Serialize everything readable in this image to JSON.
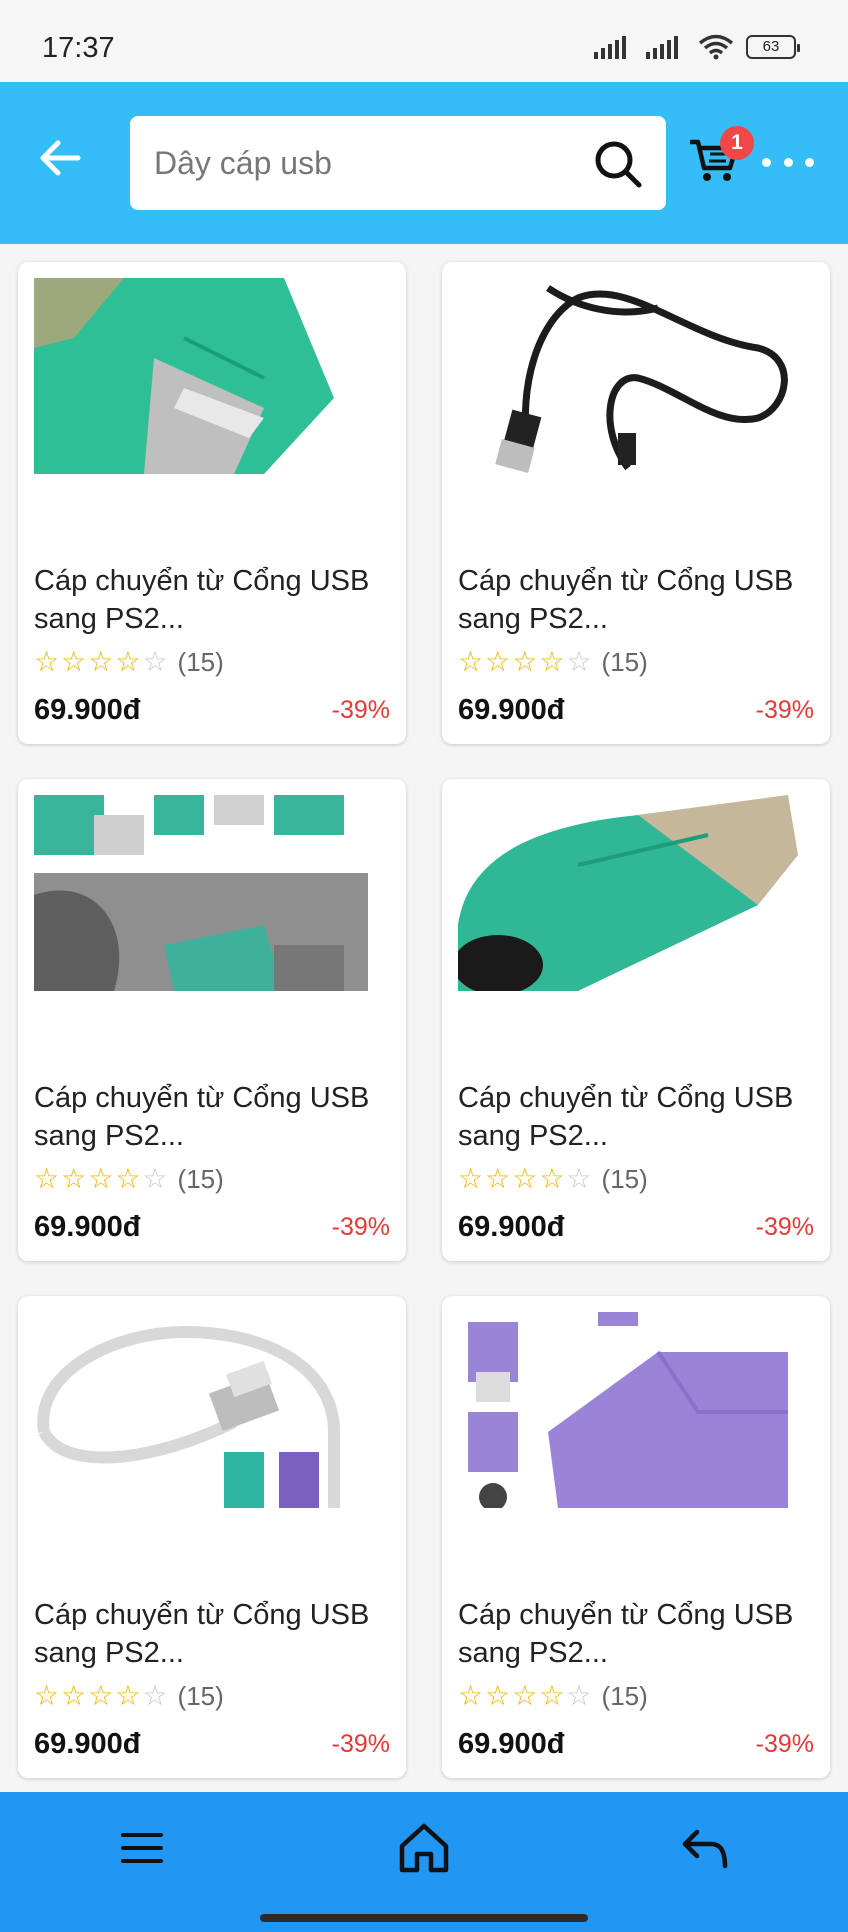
{
  "status_bar": {
    "time": "17:37",
    "battery": "63"
  },
  "header": {
    "search_placeholder": "Dây cáp usb",
    "cart_count": "1",
    "background_color": "#34bdf6",
    "icons": [
      "back-arrow-icon",
      "search-icon",
      "cart-icon",
      "more-icon"
    ]
  },
  "products": [
    {
      "title": "Cáp chuyển từ Cổng USB sang PS2...",
      "rating": 4,
      "reviews": "(15)",
      "price": "69.900đ",
      "discount": "-39%",
      "image": "green-usb-ps2-adapter-closeup"
    },
    {
      "title": "Cáp chuyển từ Cổng USB sang PS2...",
      "rating": 4,
      "reviews": "(15)",
      "price": "69.900đ",
      "discount": "-39%",
      "image": "black-usb-cable"
    },
    {
      "title": "Cáp chuyển từ Cổng USB sang PS2...",
      "rating": 4,
      "reviews": "(15)",
      "price": "69.900đ",
      "discount": "-39%",
      "image": "usb-ps2-adapters-in-use"
    },
    {
      "title": "Cáp chuyển từ Cổng USB sang PS2...",
      "rating": 4,
      "reviews": "(15)",
      "price": "69.900đ",
      "discount": "-39%",
      "image": "green-ps2-adapter"
    },
    {
      "title": "Cáp chuyển từ Cổng USB sang PS2...",
      "rating": 4,
      "reviews": "(15)",
      "price": "69.900đ",
      "discount": "-39%",
      "image": "white-usb-to-dual-ps2-cable"
    },
    {
      "title": "Cáp chuyển từ Cổng USB sang PS2...",
      "rating": 4,
      "reviews": "(15)",
      "price": "69.900đ",
      "discount": "-39%",
      "image": "purple-ps2-adapter"
    }
  ],
  "bottom_nav": {
    "background_color": "#2196f3",
    "icons": [
      "menu-icon",
      "home-icon",
      "back-return-icon"
    ]
  }
}
